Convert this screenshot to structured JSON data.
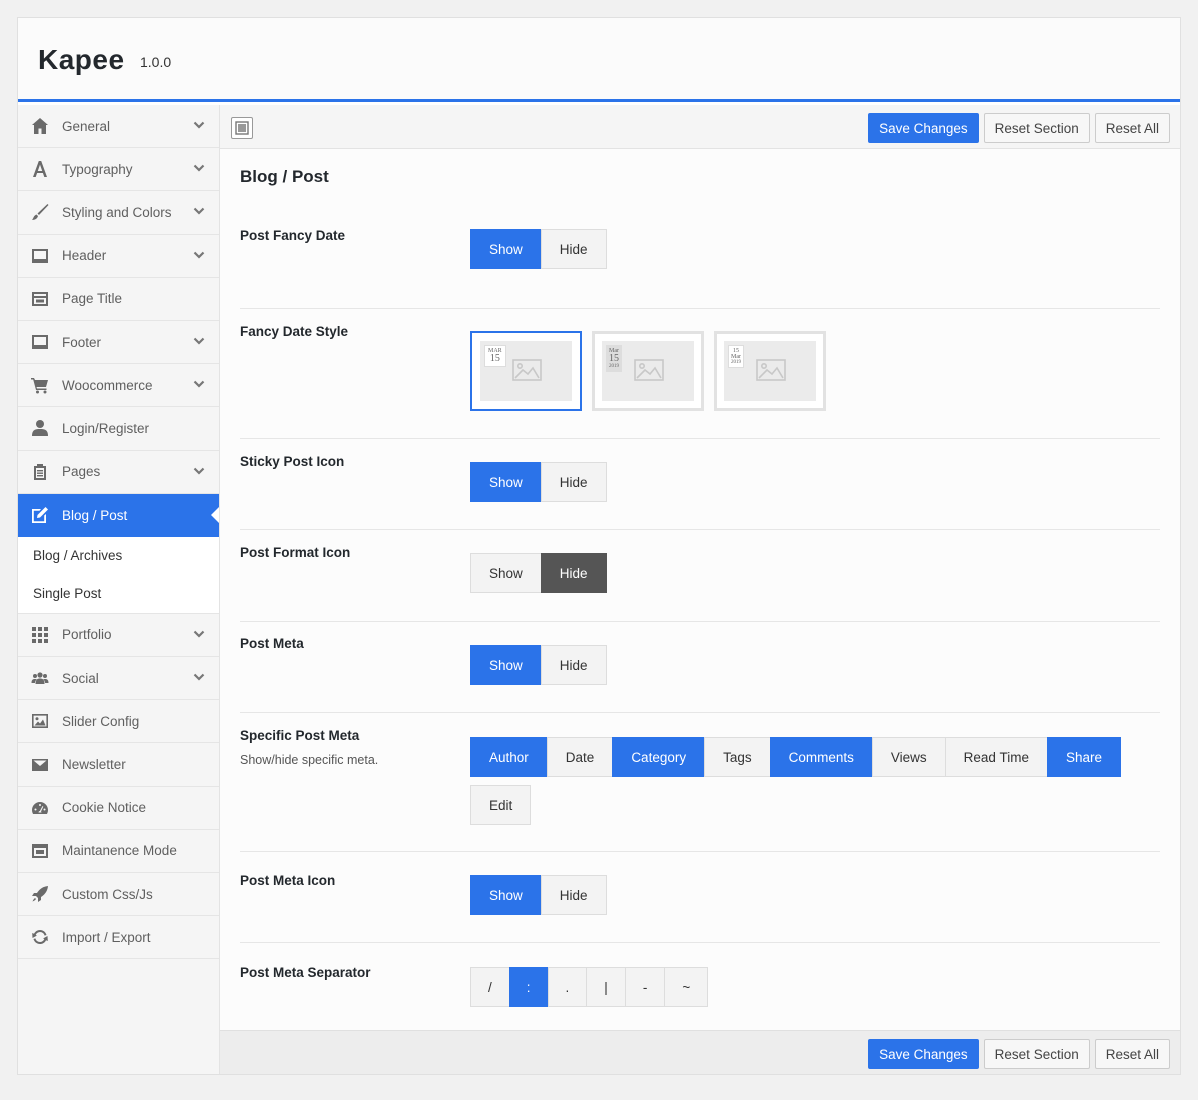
{
  "app": {
    "name": "Kapee",
    "version": "1.0.0"
  },
  "sidebar": {
    "items": [
      {
        "label": "General",
        "icon": "home-icon",
        "chevron": true
      },
      {
        "label": "Typography",
        "icon": "font-icon",
        "chevron": true
      },
      {
        "label": "Styling and Colors",
        "icon": "brush-icon",
        "chevron": true
      },
      {
        "label": "Header",
        "icon": "header-icon",
        "chevron": true
      },
      {
        "label": "Page Title",
        "icon": "page-title-icon",
        "chevron": false
      },
      {
        "label": "Footer",
        "icon": "footer-icon",
        "chevron": true
      },
      {
        "label": "Woocommerce",
        "icon": "cart-icon",
        "chevron": true
      },
      {
        "label": "Login/Register",
        "icon": "user-icon",
        "chevron": false
      },
      {
        "label": "Pages",
        "icon": "clipboard-icon",
        "chevron": true
      },
      {
        "label": "Blog / Post",
        "icon": "edit-icon",
        "chevron": false,
        "active": true
      },
      {
        "label": "Portfolio",
        "icon": "grid-icon",
        "chevron": true
      },
      {
        "label": "Social",
        "icon": "users-icon",
        "chevron": true
      },
      {
        "label": "Slider Config",
        "icon": "image-icon",
        "chevron": false
      },
      {
        "label": "Newsletter",
        "icon": "envelope-icon",
        "chevron": false
      },
      {
        "label": "Cookie Notice",
        "icon": "gauge-icon",
        "chevron": false
      },
      {
        "label": "Maintanence Mode",
        "icon": "window-icon",
        "chevron": false
      },
      {
        "label": "Custom Css/Js",
        "icon": "rocket-icon",
        "chevron": false
      },
      {
        "label": "Import / Export",
        "icon": "refresh-icon",
        "chevron": false
      }
    ],
    "subitems": [
      "Blog / Archives",
      "Single Post"
    ]
  },
  "toolbar": {
    "save_label": "Save Changes",
    "reset_section_label": "Reset Section",
    "reset_all_label": "Reset All"
  },
  "section": {
    "title": "Blog / Post"
  },
  "options": {
    "fancy_date": {
      "label": "Post Fancy Date",
      "choices": [
        "Show",
        "Hide"
      ],
      "selected": "Show"
    },
    "fancy_date_style": {
      "label": "Fancy Date Style",
      "styles": [
        {
          "line1": "MAR",
          "line2": "15",
          "line3": ""
        },
        {
          "line1": "Mar",
          "line2": "15",
          "line3": "2019"
        },
        {
          "line1": "15",
          "line2": "Mar",
          "line3": "2019"
        }
      ],
      "selected_index": 0
    },
    "sticky_icon": {
      "label": "Sticky Post Icon",
      "choices": [
        "Show",
        "Hide"
      ],
      "selected": "Show"
    },
    "format_icon": {
      "label": "Post Format Icon",
      "choices": [
        "Show",
        "Hide"
      ],
      "selected": "Hide"
    },
    "post_meta": {
      "label": "Post Meta",
      "choices": [
        "Show",
        "Hide"
      ],
      "selected": "Show"
    },
    "specific_meta": {
      "label": "Specific Post Meta",
      "description": "Show/hide specific meta.",
      "choices": [
        "Author",
        "Date",
        "Category",
        "Tags",
        "Comments",
        "Views",
        "Read Time",
        "Share",
        "Edit"
      ],
      "selected": [
        "Author",
        "Category",
        "Comments",
        "Share"
      ]
    },
    "meta_icon": {
      "label": "Post Meta Icon",
      "choices": [
        "Show",
        "Hide"
      ],
      "selected": "Show"
    },
    "meta_separator": {
      "label": "Post Meta Separator",
      "choices": [
        "/",
        ":",
        ".",
        "|",
        "-",
        "~"
      ],
      "selected": ":"
    }
  },
  "colors": {
    "accent": "#2b73e9",
    "dark_toggle": "#555555"
  }
}
